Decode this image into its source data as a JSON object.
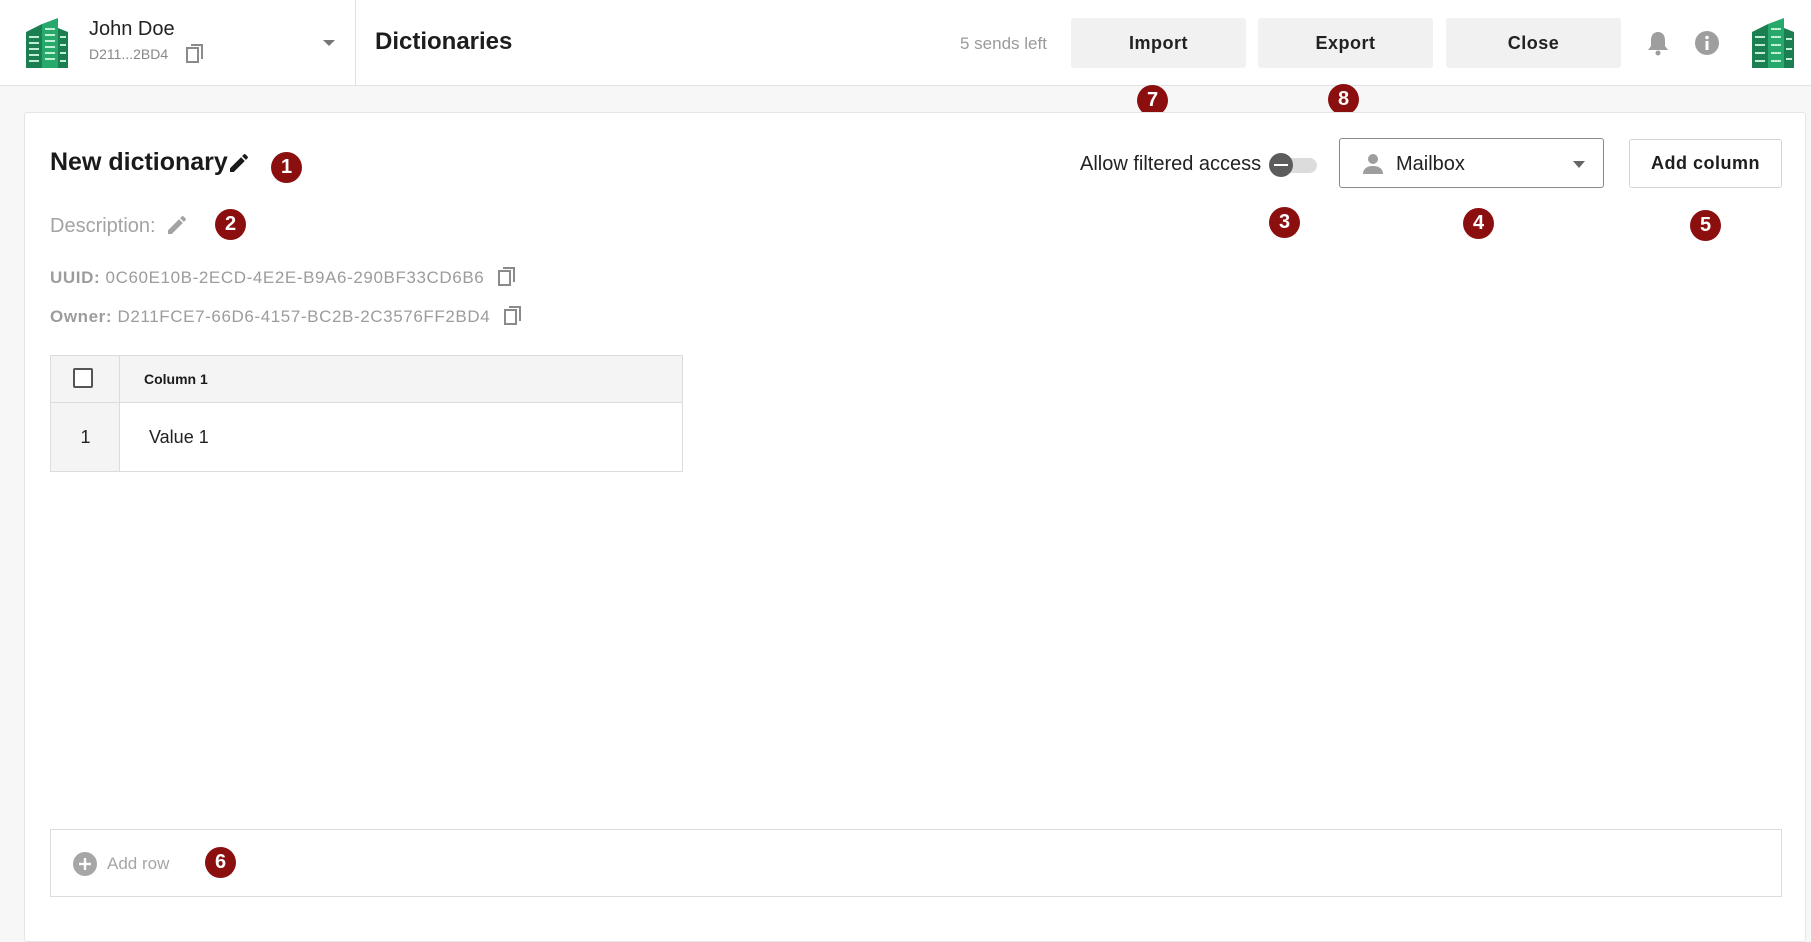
{
  "header": {
    "account_name": "John Doe",
    "account_id": "D211...2BD4",
    "page_title": "Dictionaries",
    "sends_left": "5 sends left",
    "import_label": "Import",
    "export_label": "Export",
    "close_label": "Close"
  },
  "dictionary": {
    "title": "New dictionary",
    "description_label": "Description:",
    "uuid_label": "UUID:",
    "uuid_value": "0C60E10B-2ECD-4E2E-B9A6-290BF33CD6B6",
    "owner_label": "Owner:",
    "owner_value": "D211FCE7-66D6-4157-BC2B-2C3576FF2BD4"
  },
  "controls": {
    "allow_filtered_access_label": "Allow filtered access",
    "allow_filtered_access_on": false,
    "select_value": "Mailbox",
    "add_column_label": "Add column"
  },
  "table": {
    "columns": [
      "Column 1"
    ],
    "rows": [
      {
        "index": "1",
        "cells": [
          "Value 1"
        ]
      }
    ]
  },
  "add_row_label": "Add row",
  "badges": [
    "1",
    "2",
    "3",
    "4",
    "5",
    "6",
    "7",
    "8"
  ],
  "colors": {
    "badge": "#8b0f0f",
    "brand_green": "#1f9b63"
  }
}
